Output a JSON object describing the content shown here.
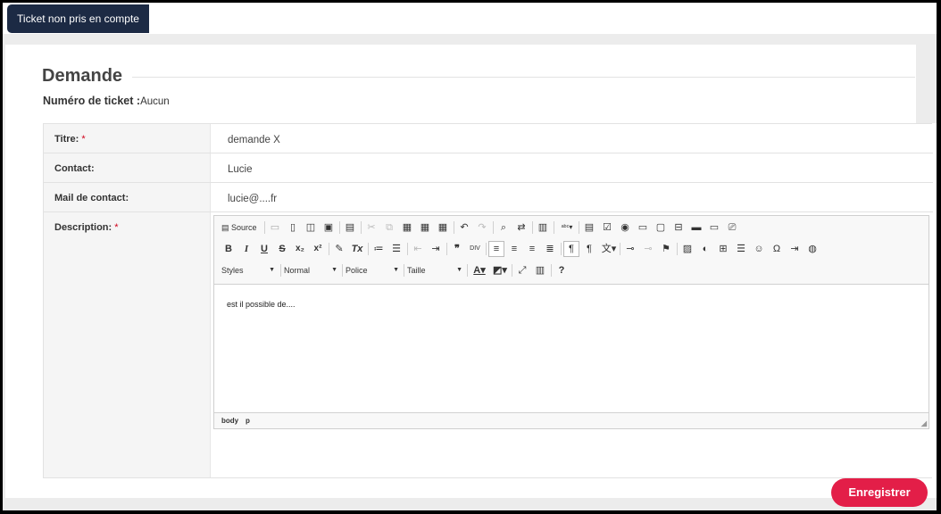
{
  "header": {
    "status_badge": "Ticket non pris en compte"
  },
  "section": {
    "title": "Demande",
    "ticket_label": "Numéro de ticket :",
    "ticket_value": "Aucun"
  },
  "form": {
    "title": {
      "label": "Titre:",
      "required": "*",
      "value": "demande X"
    },
    "contact": {
      "label": "Contact:",
      "value": "Lucie"
    },
    "email": {
      "label": "Mail de contact:",
      "value": "lucie@....fr"
    },
    "description": {
      "label": "Description:",
      "required": "*"
    }
  },
  "editor": {
    "source_label": "Source",
    "styles_label": "Styles",
    "format_label": "Normal",
    "font_label": "Police",
    "size_label": "Taille",
    "content": "est il possible de....",
    "path": [
      "body",
      "p"
    ],
    "icons": [
      "source-icon",
      "save-icon",
      "new-page-icon",
      "preview-icon",
      "print-icon",
      "templates-icon",
      "cut-icon",
      "copy-icon",
      "paste-icon",
      "paste-text-icon",
      "paste-word-icon",
      "undo-icon",
      "redo-icon",
      "find-icon",
      "replace-icon",
      "select-all-icon",
      "spellcheck-icon",
      "form-icon",
      "checkbox-icon",
      "radio-icon",
      "textfield-icon",
      "textarea-icon",
      "select-icon",
      "button-icon",
      "image-button-icon",
      "hidden-field-icon",
      "bold-icon",
      "italic-icon",
      "underline-icon",
      "strike-icon",
      "subscript-icon",
      "superscript-icon",
      "copy-format-icon",
      "remove-format-icon",
      "numbered-list-icon",
      "bulleted-list-icon",
      "outdent-icon",
      "indent-icon",
      "blockquote-icon",
      "div-icon",
      "align-left-icon",
      "align-center-icon",
      "align-right-icon",
      "justify-icon",
      "ltr-icon",
      "rtl-icon",
      "language-icon",
      "link-icon",
      "unlink-icon",
      "anchor-icon",
      "image-icon",
      "flash-icon",
      "table-icon",
      "horizontal-rule-icon",
      "smiley-icon",
      "special-char-icon",
      "page-break-icon",
      "iframe-icon",
      "text-color-icon",
      "bg-color-icon",
      "maximize-icon",
      "show-blocks-icon",
      "help-icon"
    ]
  },
  "footer": {
    "save_label": "Enregistrer"
  },
  "colors": {
    "badge_bg": "#1c2a44",
    "save_bg": "#e31e48",
    "required": "#d0021b"
  }
}
